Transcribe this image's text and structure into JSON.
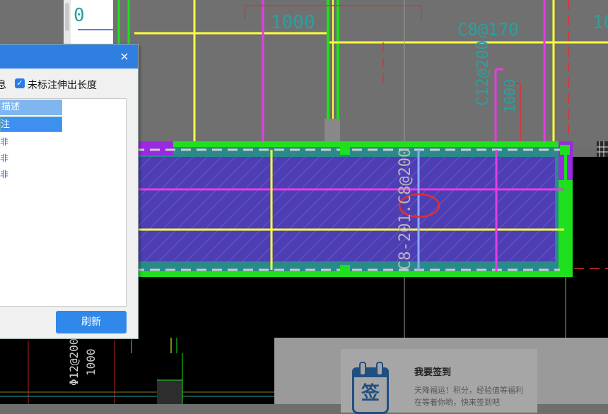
{
  "drawing": {
    "dim_top": "1000",
    "dim_right": "10",
    "rebar_top": "C8@170",
    "rebar_vertical": "C12@200",
    "dim_vertical": "1000",
    "beam_label": "C8-201.C8@200",
    "left_zero": "0",
    "bottom_rebar": "Φ12@200",
    "bottom_dim": "1000"
  },
  "dialog": {
    "close_icon": "×",
    "option_info_label": "息",
    "option_checked": true,
    "option_check_mark": "✓",
    "option_label": "未标注伸出长度",
    "list_header": "描述",
    "list_selected": "注",
    "list_rows": [
      "非",
      "非",
      "非"
    ],
    "refresh_label": "刷新"
  },
  "popup": {
    "icon_glyph": "签",
    "title": "我要签到",
    "description": "天降福运！积分，经验值等福利在等着你哟，快来签到吧"
  },
  "colors": {
    "background": "#6e6e6e",
    "green": "#1ee01e",
    "yellow": "#ffff3c",
    "magenta": "#e63ce6",
    "red": "#e03030",
    "beam_fill": "#4b3fb0",
    "dialog_title": "#2f7fe0",
    "accent_button": "#2f88ea"
  }
}
